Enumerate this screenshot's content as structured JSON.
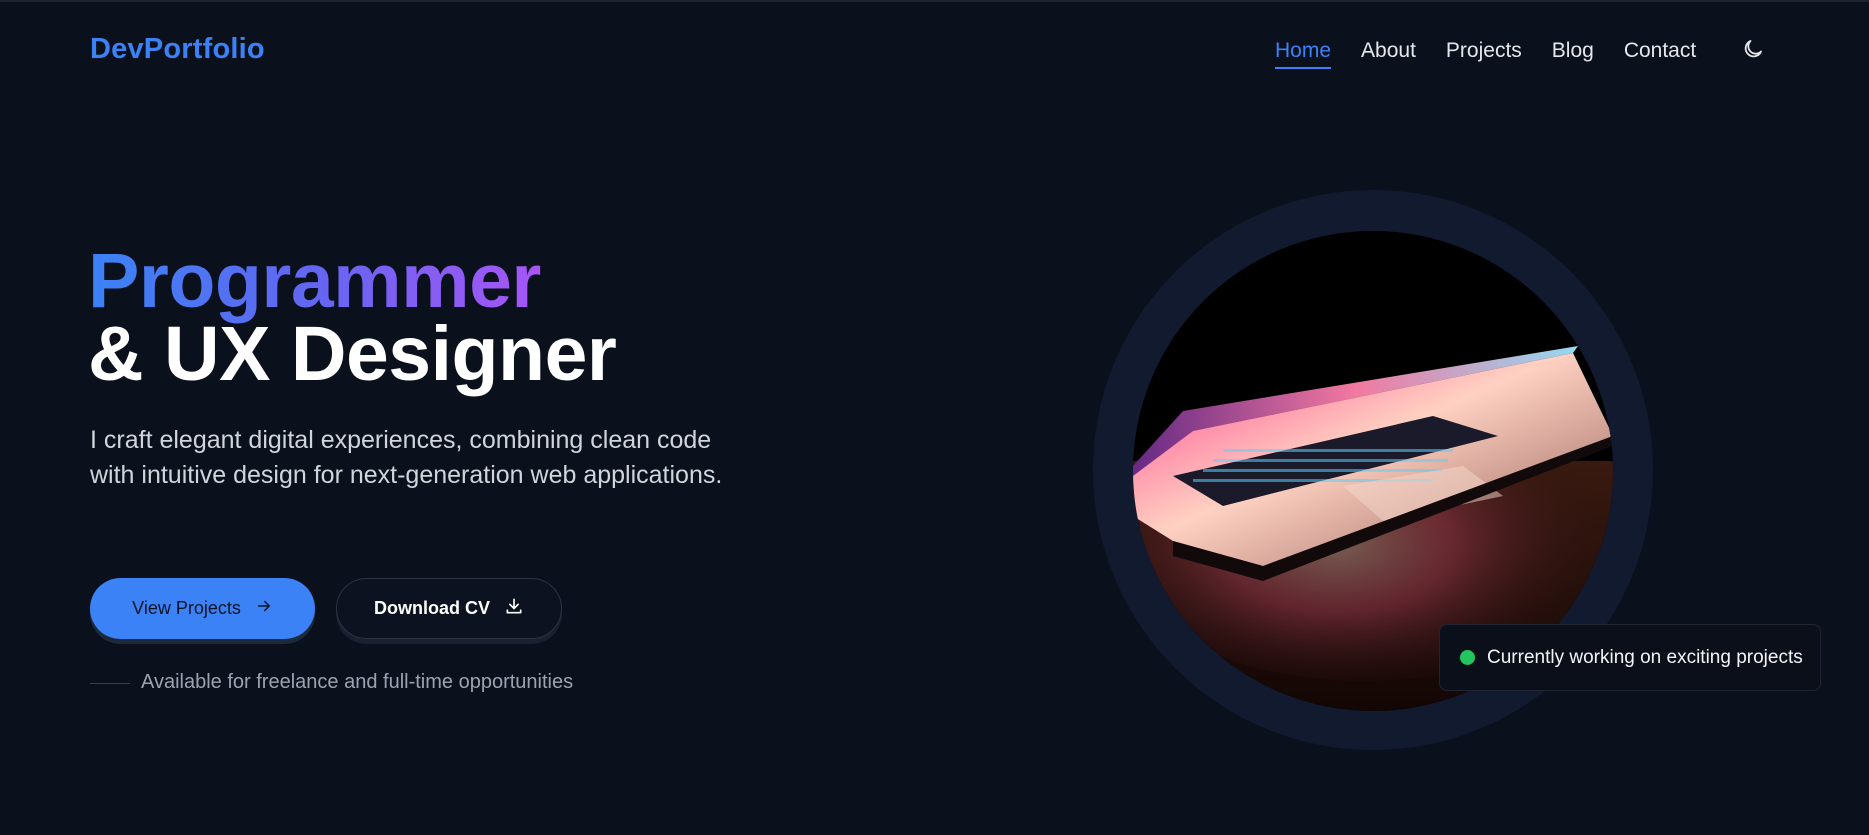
{
  "header": {
    "logo": "DevPortfolio",
    "nav": [
      {
        "label": "Home",
        "active": true
      },
      {
        "label": "About",
        "active": false
      },
      {
        "label": "Projects",
        "active": false
      },
      {
        "label": "Blog",
        "active": false
      },
      {
        "label": "Contact",
        "active": false
      }
    ],
    "theme_toggle_icon": "moon-icon"
  },
  "hero": {
    "title_line1": "Programmer",
    "title_line2": "& UX Designer",
    "description": "I craft elegant digital experiences, combining clean code with intuitive design for next-generation web applications.",
    "primary_button": {
      "label": "View Projects",
      "icon": "arrow-right-icon"
    },
    "secondary_button": {
      "label": "Download CV",
      "icon": "download-icon"
    },
    "availability": "Available for freelance and full-time opportunities",
    "status": "Currently working on exciting projects",
    "image_subject": "laptop-photo"
  },
  "colors": {
    "background": "#0b101d",
    "accent": "#3b82f6",
    "gradient_end": "#a855f7",
    "status": "#22c55e"
  }
}
